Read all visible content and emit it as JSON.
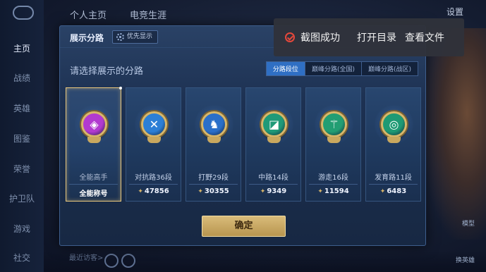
{
  "background": {
    "tabs": [
      "个人主页",
      "电竞生涯"
    ],
    "settings": "设置",
    "sidebar": [
      {
        "label": "主页",
        "active": true
      },
      {
        "label": "战绩",
        "active": false
      },
      {
        "label": "英雄",
        "active": false
      },
      {
        "label": "图鉴",
        "active": false
      },
      {
        "label": "荣誉",
        "active": false
      },
      {
        "label": "护卫队",
        "active": false
      },
      {
        "label": "游戏",
        "active": false
      },
      {
        "label": "社交",
        "active": false
      }
    ],
    "bottom_hint": "最近访客>",
    "right_tags": [
      "模型",
      "换英雄"
    ]
  },
  "dialog": {
    "title": "展示分路",
    "priority_button": "优先显示",
    "prompt": "请选择展示的分路",
    "filter_tabs": [
      {
        "label": "分路段位",
        "active": true
      },
      {
        "label": "巅峰分路(全国)",
        "active": false
      },
      {
        "label": "巅峰分路(战区)",
        "active": false
      }
    ],
    "cards": [
      {
        "name": "全能高手",
        "score": "全能称号",
        "selected": true,
        "emblem_icon": "all-round-icon",
        "color": "#b23ad0",
        "glyph": "◈"
      },
      {
        "name": "对抗路36段",
        "score": "47856",
        "selected": false,
        "emblem_icon": "clash-lane-icon",
        "color": "#2c7fd6",
        "glyph": "✕"
      },
      {
        "name": "打野29段",
        "score": "30355",
        "selected": false,
        "emblem_icon": "jungle-icon",
        "color": "#2a6fc9",
        "glyph": "♞"
      },
      {
        "name": "中路14段",
        "score": "9349",
        "selected": false,
        "emblem_icon": "mid-lane-icon",
        "color": "#1f9a78",
        "glyph": "◪"
      },
      {
        "name": "游走16段",
        "score": "11594",
        "selected": false,
        "emblem_icon": "roam-icon",
        "color": "#229e73",
        "glyph": "⚚"
      },
      {
        "name": "发育路11段",
        "score": "6483",
        "selected": false,
        "emblem_icon": "farm-lane-icon",
        "color": "#1e9a74",
        "glyph": "◎"
      }
    ],
    "confirm": "确定"
  },
  "toast": {
    "message": "截图成功",
    "open_folder": "打开目录",
    "view_file": "查看文件"
  }
}
